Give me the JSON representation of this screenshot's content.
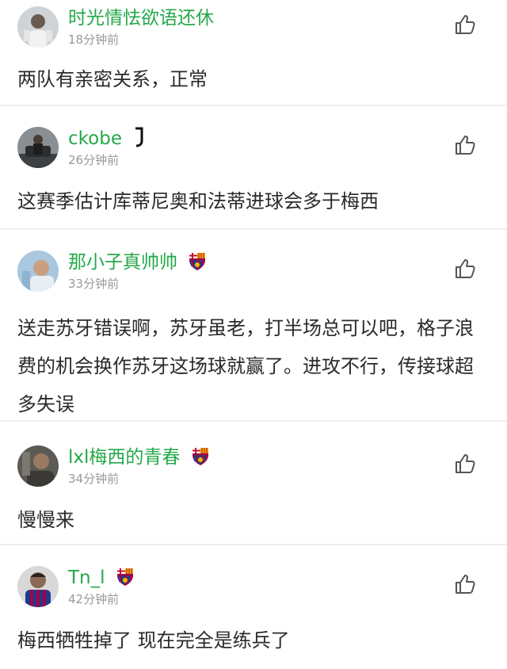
{
  "colors": {
    "username": "#25a84a",
    "time": "#999999",
    "text": "#2a2a2a",
    "divider": "#ededed"
  },
  "comments": [
    {
      "username": "时光情怯欲语还休",
      "time": "18分钟前",
      "text": "两队有亲密关系，正常",
      "badge": null,
      "avatar_icon": "avatar-person-icon",
      "like_icon": "thumbs-up-icon"
    },
    {
      "username": "ckobe",
      "time": "26分钟前",
      "text": "这赛季估计库蒂尼奥和法蒂进球会多于梅西",
      "badge": "juventus-logo-icon",
      "avatar_icon": "avatar-person-icon",
      "like_icon": "thumbs-up-icon"
    },
    {
      "username": "那小子真帅帅",
      "time": "33分钟前",
      "text": "送走苏牙错误啊，苏牙虽老，打半场总可以吧，格子浪费的机会换作苏牙这场球就赢了。进攻不行，传接球超多失误",
      "badge": "barcelona-crest-icon",
      "avatar_icon": "avatar-person-icon",
      "like_icon": "thumbs-up-icon"
    },
    {
      "username": "lxl梅西的青春",
      "time": "34分钟前",
      "text": "慢慢来",
      "badge": "barcelona-crest-icon",
      "avatar_icon": "avatar-person-icon",
      "like_icon": "thumbs-up-icon"
    },
    {
      "username": "Tn_l",
      "time": "42分钟前",
      "text": "梅西牺牲掉了 现在完全是练兵了",
      "badge": "barcelona-crest-icon",
      "avatar_icon": "avatar-person-icon",
      "like_icon": "thumbs-up-icon"
    }
  ]
}
